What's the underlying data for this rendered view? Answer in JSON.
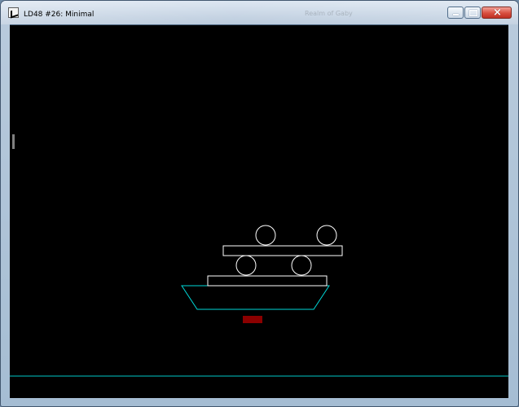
{
  "window": {
    "title": "LD48 #26: Minimal",
    "background_title": "Realm of Gaby",
    "controls": {
      "minimize_symbol": "",
      "maximize_symbol": "",
      "close_symbol": "×"
    }
  },
  "game": {
    "background_color": "#000000",
    "ground_color": "#00c8c8",
    "boat_color": "#00d8d8",
    "object_color": "#ffffff",
    "marker_color": "#8b0000"
  },
  "icons": {
    "app_icon": "app-icon",
    "minimize_icon": "minimize-icon",
    "maximize_icon": "maximize-icon",
    "close_icon": "close-icon"
  }
}
